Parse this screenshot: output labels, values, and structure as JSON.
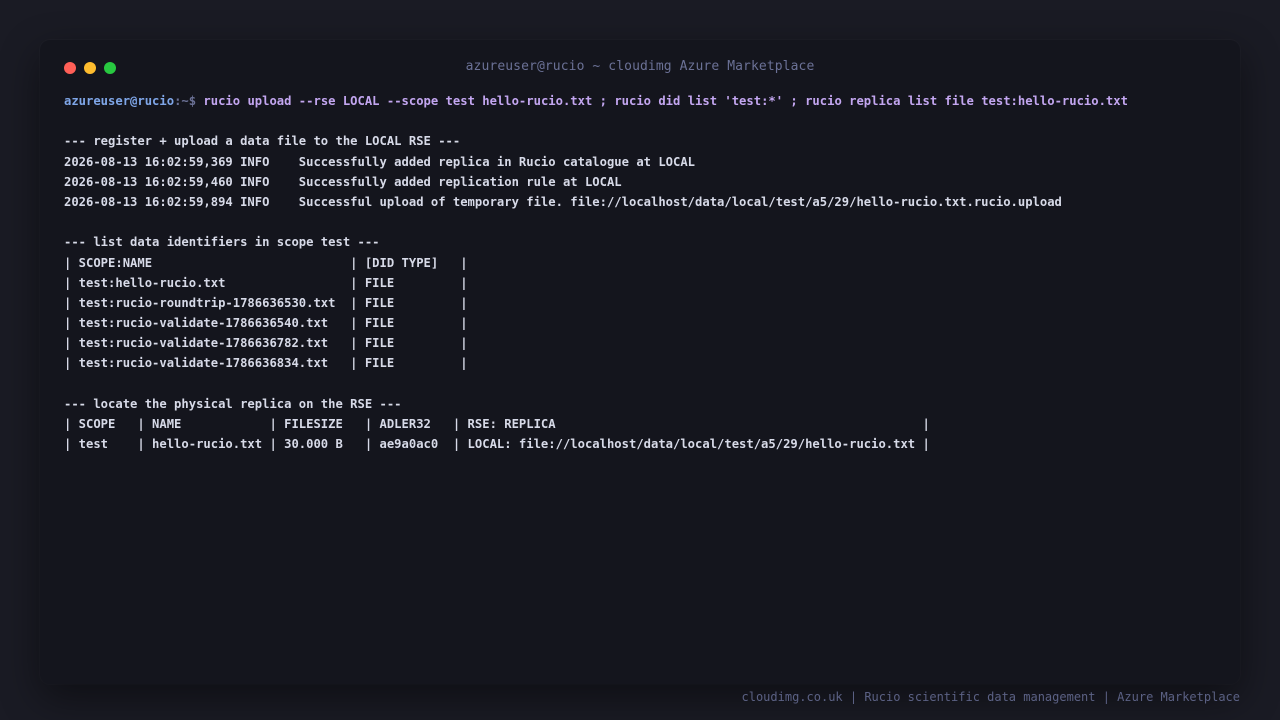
{
  "window": {
    "title": "azureuser@rucio ~ cloudimg Azure Marketplace"
  },
  "terminal": {
    "prompt_user": "azureuser@rucio",
    "prompt_path": ":~$ ",
    "command": "rucio upload --rse LOCAL --scope test hello-rucio.txt ; rucio did list 'test:*' ; rucio replica list file test:hello-rucio.txt",
    "upload_section": {
      "heading": "--- register + upload a data file to the LOCAL RSE ---",
      "log_lines": [
        "2026-08-13 16:02:59,369 INFO    Successfully added replica in Rucio catalogue at LOCAL",
        "2026-08-13 16:02:59,460 INFO    Successfully added replication rule at LOCAL",
        "2026-08-13 16:02:59,894 INFO    Successful upload of temporary file. file://localhost/data/local/test/a5/29/hello-rucio.txt.rucio.upload"
      ]
    },
    "did_section": {
      "heading": "--- list data identifiers in scope test ---",
      "rows": [
        "| SCOPE:NAME                           | [DID TYPE]   |",
        "| test:hello-rucio.txt                 | FILE         |",
        "| test:rucio-roundtrip-1786636530.txt  | FILE         |",
        "| test:rucio-validate-1786636540.txt   | FILE         |",
        "| test:rucio-validate-1786636782.txt   | FILE         |",
        "| test:rucio-validate-1786636834.txt   | FILE         |"
      ]
    },
    "replica_section": {
      "heading": "--- locate the physical replica on the RSE ---",
      "rows": [
        "| SCOPE   | NAME            | FILESIZE   | ADLER32   | RSE: REPLICA                                                  |",
        "| test    | hello-rucio.txt | 30.000 B   | ae9a0ac0  | LOCAL: file://localhost/data/local/test/a5/29/hello-rucio.txt |"
      ]
    }
  },
  "footer": {
    "text": "cloudimg.co.uk | Rucio scientific data management | Azure Marketplace"
  },
  "colors": {
    "background": "#1a1b24",
    "terminal_bg": "#14151d",
    "text": "#d7dae8",
    "prompt_user": "#7fa6e8",
    "command": "#c3a6f0",
    "muted": "#6b7196"
  },
  "icons": [
    "close-dot-icon",
    "minimize-dot-icon",
    "maximize-dot-icon"
  ]
}
